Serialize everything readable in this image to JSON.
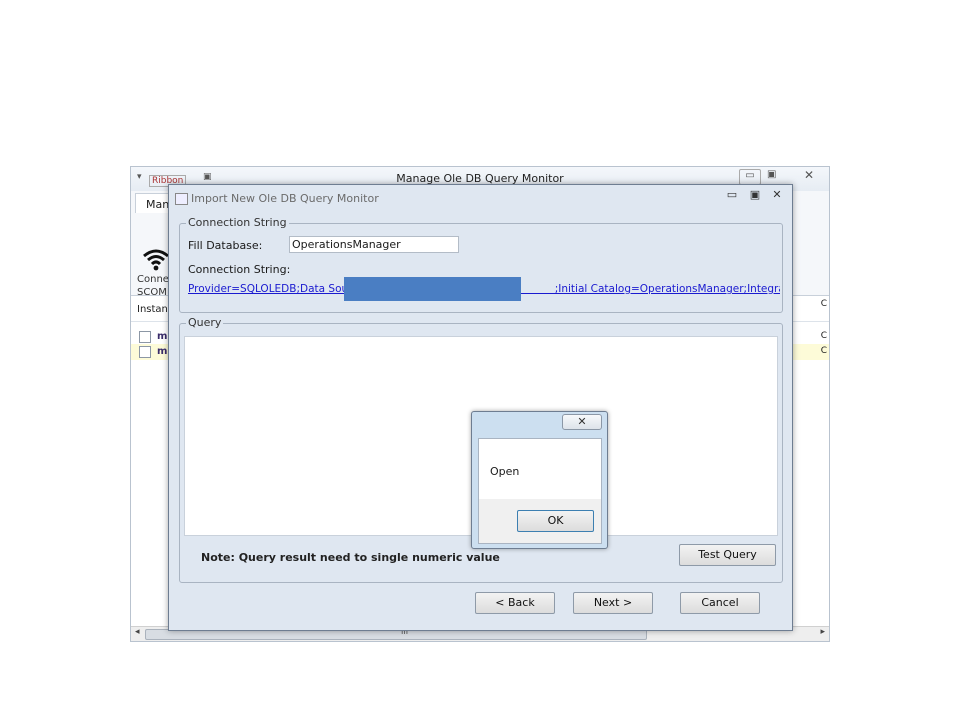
{
  "main_window": {
    "title": "Manage Ole DB Query Monitor",
    "qat_label": "Ribbon",
    "ribbon_tab": "Mana",
    "connect_button": "Conne\nSCOM",
    "column_instance": "Instan",
    "column_right": "C",
    "rows": [
      {
        "text": "mk",
        "right": "C",
        "selected": false
      },
      {
        "text": "mk",
        "right": "C",
        "selected": true
      }
    ],
    "scroll_grip": "III",
    "scroll_left": "◂",
    "scroll_right": "▸"
  },
  "dialog": {
    "title": "Import New Ole DB Query Monitor",
    "connection_group_title": "Connection String",
    "fill_database_label": "Fill Database:",
    "fill_database_value": "OperationsManager",
    "connection_string_label": "Connection String:",
    "connection_string_value": "Provider=SQLOLEDB;Data Source                                                         ;Initial Catalog=OperationsManager;Integrated Security",
    "query_group_title": "Query",
    "query_text": "",
    "note": "Note: Query result need to single numeric value",
    "test_query_label": "Test Query",
    "back_label": "< Back",
    "next_label": "Next >",
    "cancel_label": "Cancel"
  },
  "message_box": {
    "text": "Open",
    "ok_label": "OK"
  },
  "colors": {
    "dialog_bg": "#dfe7f1",
    "link": "#1a1ad0",
    "redaction": "#4a7ec3",
    "selected_row": "#fdfbd8"
  }
}
